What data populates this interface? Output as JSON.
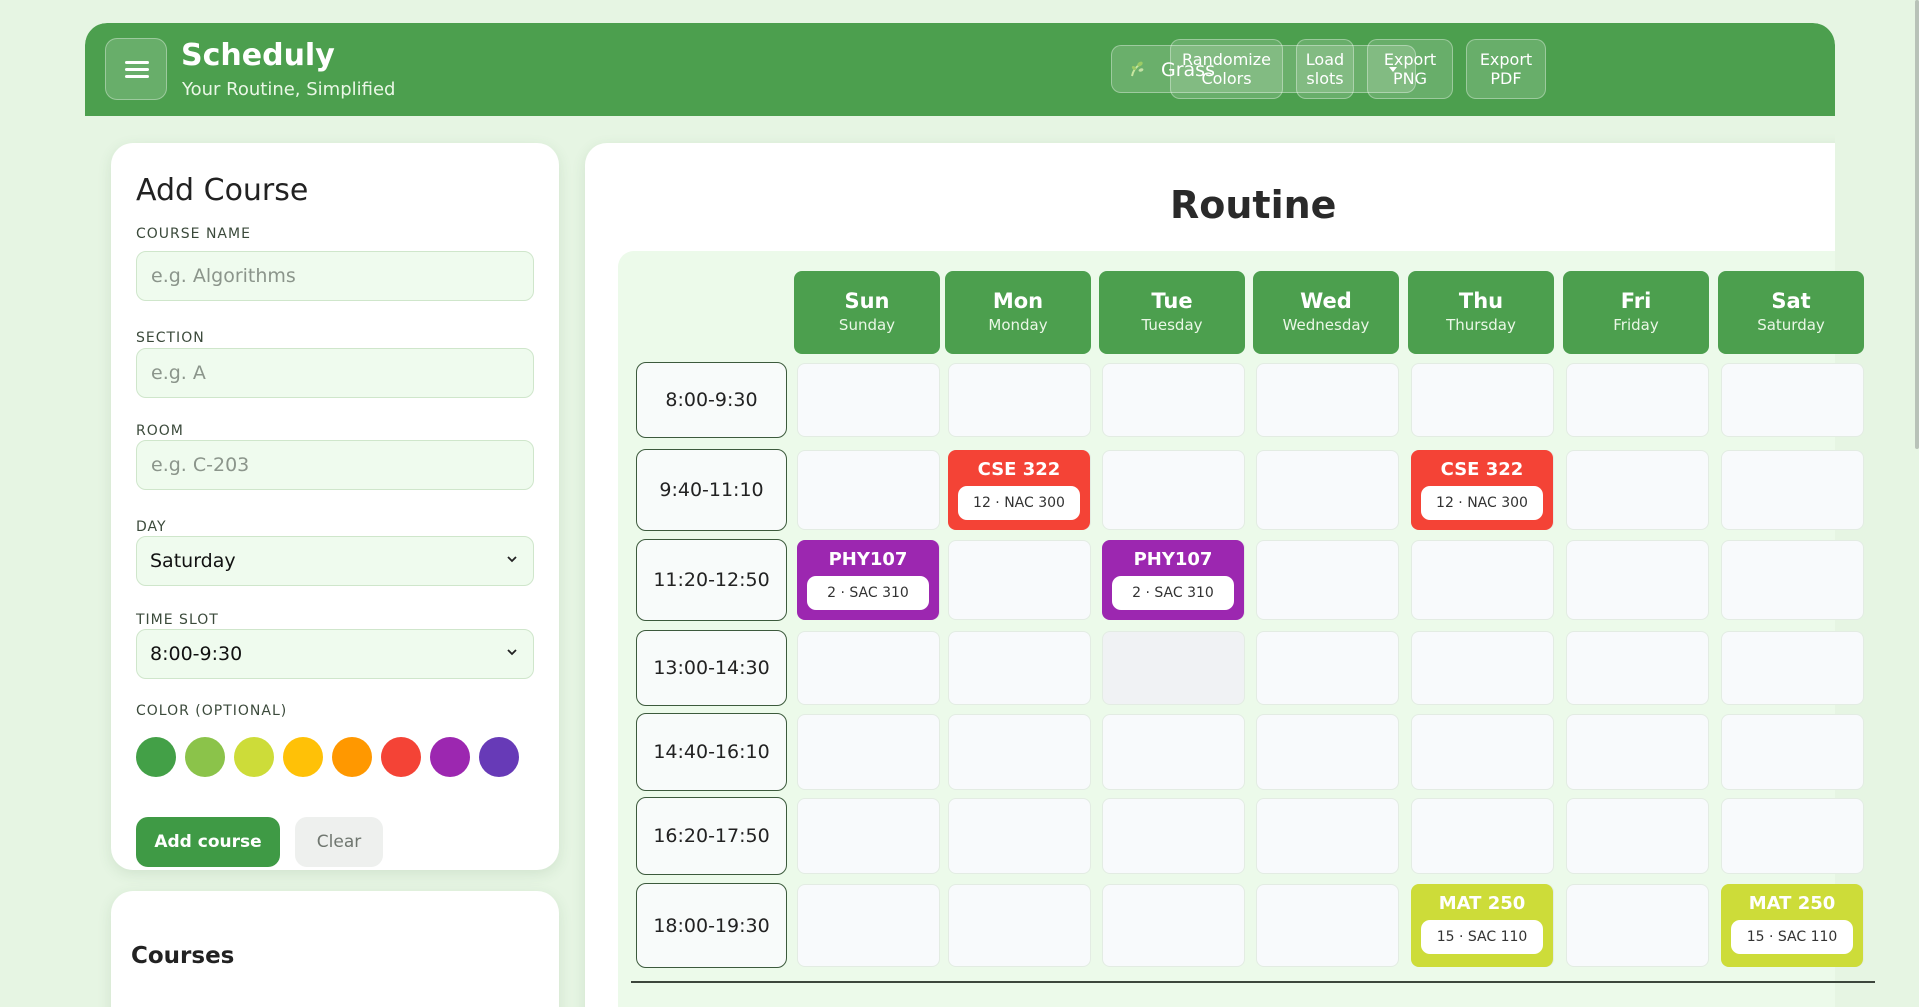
{
  "header": {
    "title": "Scheduly",
    "subtitle": "Your Routine, Simplified",
    "theme": "Grass",
    "buttons": {
      "randomize": "Randomize Colors",
      "load": "Load slots",
      "export_png": "Export PNG",
      "export_pdf": "Export PDF"
    }
  },
  "form": {
    "title": "Add Course",
    "course_name_label": "COURSE NAME",
    "course_name_placeholder": "e.g. Algorithms",
    "section_label": "SECTION",
    "section_placeholder": "e.g. A",
    "room_label": "ROOM",
    "room_placeholder": "e.g. C-203",
    "day_label": "DAY",
    "day_value": "Saturday",
    "timeslot_label": "TIME SLOT",
    "timeslot_value": "8:00-9:30",
    "color_label": "COLOR (OPTIONAL)",
    "colors": [
      "#43a047",
      "#8bc34a",
      "#cddc39",
      "#ffc107",
      "#ff9800",
      "#f44336",
      "#9c27b0",
      "#673ab7"
    ],
    "add_label": "Add course",
    "clear_label": "Clear"
  },
  "courses_section": {
    "title": "Courses"
  },
  "routine": {
    "title": "Routine",
    "days": [
      {
        "short": "Sun",
        "long": "Sunday"
      },
      {
        "short": "Mon",
        "long": "Monday"
      },
      {
        "short": "Tue",
        "long": "Tuesday"
      },
      {
        "short": "Wed",
        "long": "Wednesday"
      },
      {
        "short": "Thu",
        "long": "Thursday"
      },
      {
        "short": "Fri",
        "long": "Friday"
      },
      {
        "short": "Sat",
        "long": "Saturday"
      }
    ],
    "times": [
      "8:00-9:30",
      "9:40-11:10",
      "11:20-12:50",
      "13:00-14:30",
      "14:40-16:10",
      "16:20-17:50",
      "18:00-19:30"
    ],
    "courses": [
      {
        "name": "CSE 322",
        "meta": "12 · NAC 300",
        "day": 1,
        "slot": 1,
        "color": "#f44336"
      },
      {
        "name": "CSE 322",
        "meta": "12 · NAC 300",
        "day": 4,
        "slot": 1,
        "color": "#f44336"
      },
      {
        "name": "PHY107",
        "meta": "2 · SAC 310",
        "day": 0,
        "slot": 2,
        "color": "#9c27b0"
      },
      {
        "name": "PHY107",
        "meta": "2 · SAC 310",
        "day": 2,
        "slot": 2,
        "color": "#9c27b0"
      },
      {
        "name": "MAT 250",
        "meta": "15 · SAC 110",
        "day": 4,
        "slot": 6,
        "color": "#cddc39"
      },
      {
        "name": "MAT 250",
        "meta": "15 · SAC 110",
        "day": 6,
        "slot": 6,
        "color": "#cddc39"
      }
    ]
  }
}
